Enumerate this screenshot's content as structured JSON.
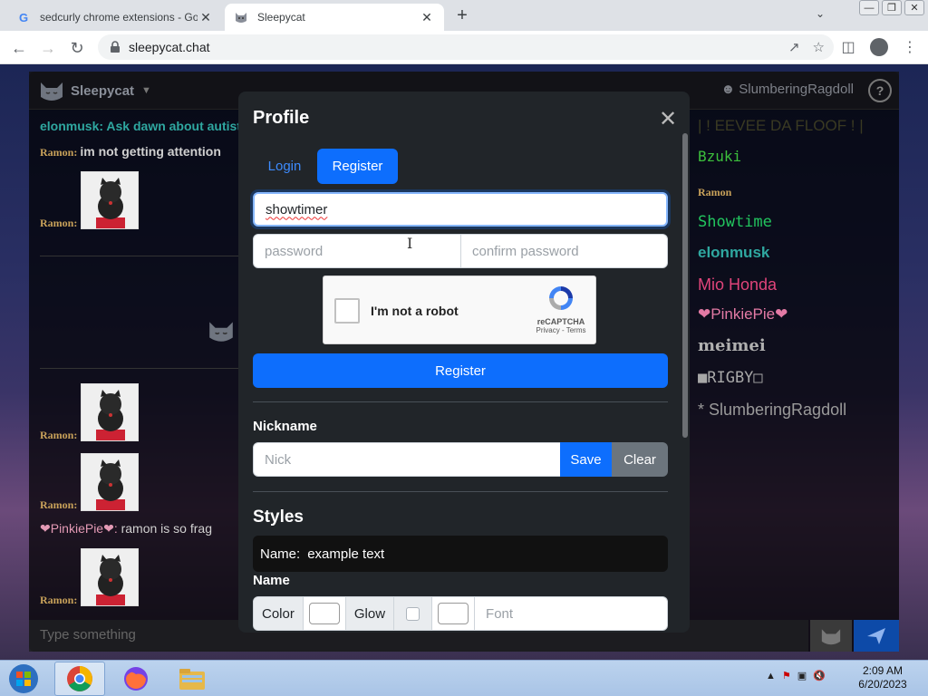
{
  "browser": {
    "tabs": [
      {
        "title": "sedcurly chrome extensions - Go",
        "favicon": "google-icon"
      },
      {
        "title": "Sleepycat",
        "favicon": "cat-icon"
      }
    ],
    "new_tab": "+",
    "url": "sleepycat.chat"
  },
  "chat": {
    "brand": "Sleepycat",
    "current_user": "SlumberingRagdoll",
    "help": "?",
    "messages": [
      {
        "name": "elonmusk",
        "sep": ": ",
        "text": "Ask dawn about autists"
      },
      {
        "name": "Ramon",
        "sep": ": ",
        "text": "im not getting attention"
      },
      {
        "name": "Ramon",
        "sep": ":",
        "text": ""
      },
      {
        "name": "Ramon",
        "sep": ":",
        "text": ""
      },
      {
        "name": "Ramon",
        "sep": ":",
        "text": ""
      },
      {
        "name": "❤PinkiePie❤",
        "sep": ": ",
        "text": "ramon is so frag"
      },
      {
        "name": "Ramon",
        "sep": ":",
        "text": ""
      }
    ],
    "userlist": [
      {
        "name": "| ! EEVEE DA FLOOF ! |",
        "color": "#3a3a22"
      },
      {
        "name": "Bzuki",
        "color": "#3cbf3c"
      },
      {
        "name": "Ramon",
        "color": "#c9a25a"
      },
      {
        "name": "Showtime",
        "color": "#22c55e"
      },
      {
        "name": "elonmusk",
        "color": "#2fa7a0"
      },
      {
        "name": "Mio Honda",
        "color": "#e0447a"
      },
      {
        "name": "❤PinkiePie❤",
        "color": "#e37aa5"
      },
      {
        "name": "meimei",
        "color": "#b0b0b0"
      },
      {
        "name": "■RIGBY□",
        "color": "#a8a8a8"
      },
      {
        "name": "* SlumberingRagdoll",
        "color": "#9a9a9a"
      }
    ],
    "input_placeholder": "Type something"
  },
  "modal": {
    "title": "Profile",
    "close": "✕",
    "tabs": {
      "login": "Login",
      "register": "Register"
    },
    "username_value": "showtimer",
    "password_placeholder": "password",
    "confirm_placeholder": "confirm password",
    "captcha": {
      "label": "I'm not a robot",
      "brand": "reCAPTCHA",
      "links": "Privacy - Terms"
    },
    "register_button": "Register",
    "nickname_label": "Nickname",
    "nick_placeholder": "Nick",
    "save_button": "Save",
    "clear_button": "Clear",
    "styles_heading": "Styles",
    "preview_name": "Name:",
    "preview_text": "example text",
    "name_label": "Name",
    "color_label": "Color",
    "glow_label": "Glow",
    "font_placeholder": "Font"
  },
  "taskbar": {
    "time": "2:09 AM",
    "date": "6/20/2023"
  },
  "colors": {
    "accent": "#0d6efd",
    "modal_bg": "#212529",
    "elonmusk": "#2fa7a0",
    "ramon": "#c9a25a"
  }
}
